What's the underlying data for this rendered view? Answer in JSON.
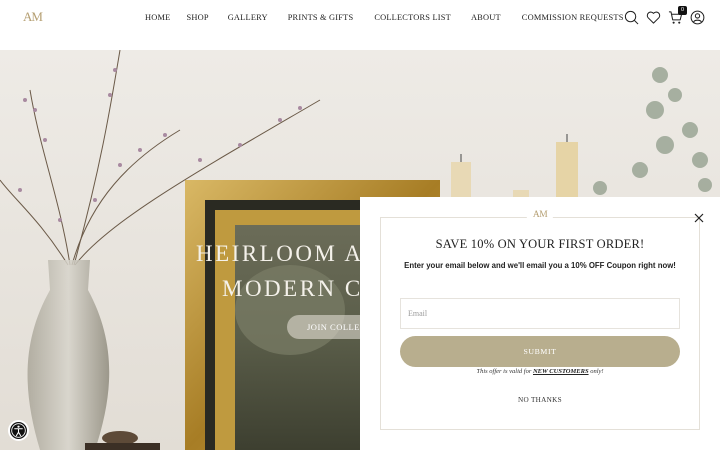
{
  "header": {
    "logo": "AM",
    "nav": [
      "HOME",
      "SHOP",
      "GALLERY",
      "PRINTS & GIFTS",
      "COLLECTORS LIST",
      "ABOUT",
      "COMMISSION REQUESTS"
    ],
    "icons": [
      "search-icon",
      "heart-icon",
      "cart-icon",
      "account-icon"
    ],
    "cart_count": "0"
  },
  "hero": {
    "title": "HEIRLOOM A",
    "subtitle": "MODERN C",
    "button": "JOIN COLLE"
  },
  "popup": {
    "logo": "AM",
    "title": "SAVE 10% ON YOUR FIRST ORDER!",
    "description": "Enter your email below and we'll email you a 10% OFF Coupon right now!",
    "email_placeholder": "Email",
    "submit": "SUBMIT",
    "note_prefix": "This offer is valid for ",
    "note_link": "NEW CUSTOMERS",
    "note_suffix": " only!",
    "no_thanks": "NO THANKS"
  },
  "colors": {
    "accent": "#b59f72",
    "button": "#b8ae8e",
    "frame_gold": "#b8922e"
  }
}
